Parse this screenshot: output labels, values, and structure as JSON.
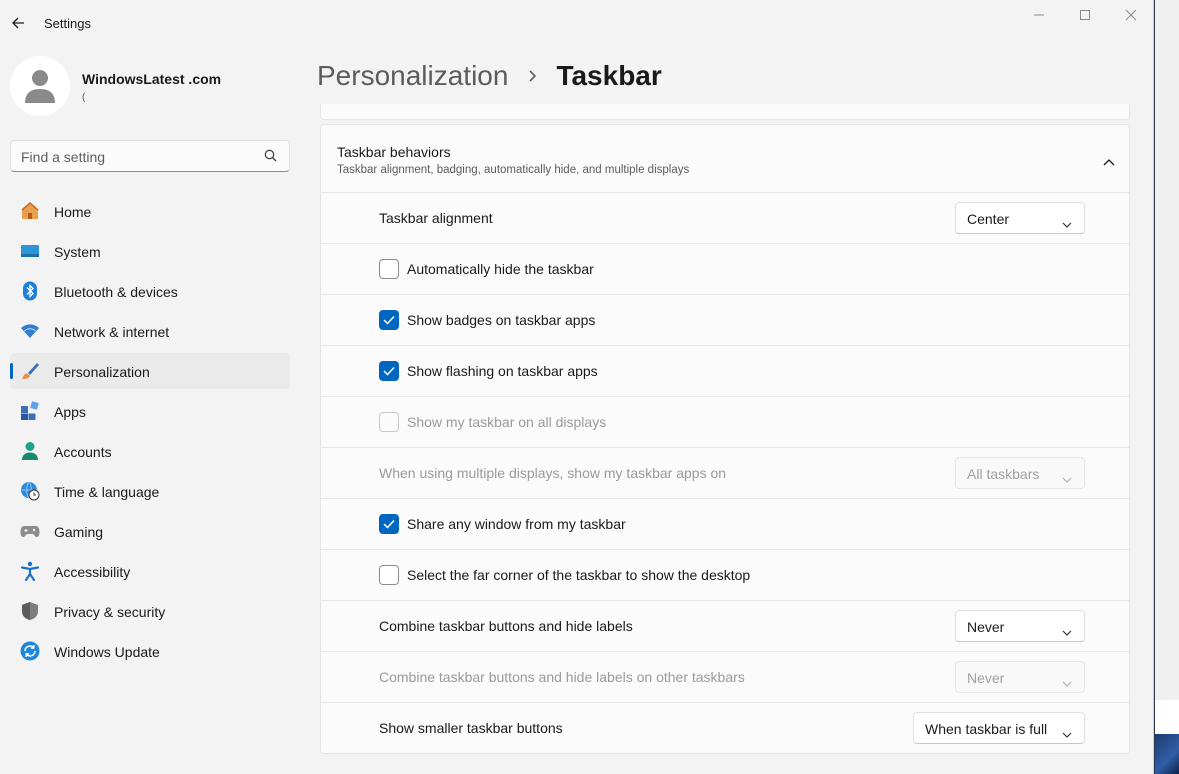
{
  "window": {
    "title": "Settings"
  },
  "profile": {
    "name": "WindowsLatest .com",
    "sub": "("
  },
  "search": {
    "placeholder": "Find a setting",
    "icon": "search-icon"
  },
  "nav": {
    "items": [
      {
        "label": "Home",
        "icon": "home-icon",
        "active": false
      },
      {
        "label": "System",
        "icon": "system-icon",
        "active": false
      },
      {
        "label": "Bluetooth & devices",
        "icon": "bluetooth-icon",
        "active": false
      },
      {
        "label": "Network & internet",
        "icon": "wifi-icon",
        "active": false
      },
      {
        "label": "Personalization",
        "icon": "brush-icon",
        "active": true
      },
      {
        "label": "Apps",
        "icon": "apps-icon",
        "active": false
      },
      {
        "label": "Accounts",
        "icon": "accounts-icon",
        "active": false
      },
      {
        "label": "Time & language",
        "icon": "globe-clock-icon",
        "active": false
      },
      {
        "label": "Gaming",
        "icon": "gamepad-icon",
        "active": false
      },
      {
        "label": "Accessibility",
        "icon": "accessibility-icon",
        "active": false
      },
      {
        "label": "Privacy & security",
        "icon": "shield-icon",
        "active": false
      },
      {
        "label": "Windows Update",
        "icon": "update-icon",
        "active": false
      }
    ]
  },
  "header": {
    "parent": "Personalization",
    "current": "Taskbar"
  },
  "section": {
    "title": "Taskbar behaviors",
    "description": "Taskbar alignment, badging, automatically hide, and multiple displays",
    "rows": [
      {
        "type": "dropdown",
        "label": "Taskbar alignment",
        "value": "Center",
        "disabled": false
      },
      {
        "type": "checkbox",
        "label": "Automatically hide the taskbar",
        "checked": false,
        "disabled": false
      },
      {
        "type": "checkbox",
        "label": "Show badges on taskbar apps",
        "checked": true,
        "disabled": false
      },
      {
        "type": "checkbox",
        "label": "Show flashing on taskbar apps",
        "checked": true,
        "disabled": false
      },
      {
        "type": "checkbox",
        "label": "Show my taskbar on all displays",
        "checked": false,
        "disabled": true
      },
      {
        "type": "dropdown",
        "label": "When using multiple displays, show my taskbar apps on",
        "value": "All taskbars",
        "disabled": true
      },
      {
        "type": "checkbox",
        "label": "Share any window from my taskbar",
        "checked": true,
        "disabled": false
      },
      {
        "type": "checkbox",
        "label": "Select the far corner of the taskbar to show the desktop",
        "checked": false,
        "disabled": false
      },
      {
        "type": "dropdown",
        "label": "Combine taskbar buttons and hide labels",
        "value": "Never",
        "disabled": false
      },
      {
        "type": "dropdown",
        "label": "Combine taskbar buttons and hide labels on other taskbars",
        "value": "Never",
        "disabled": true
      },
      {
        "type": "dropdown",
        "label": "Show smaller taskbar buttons",
        "value": "When taskbar is full",
        "disabled": false
      }
    ]
  },
  "colors": {
    "accent": "#0067c0",
    "window_bg": "#f3f3f3",
    "card_bg": "#fbfbfb"
  }
}
